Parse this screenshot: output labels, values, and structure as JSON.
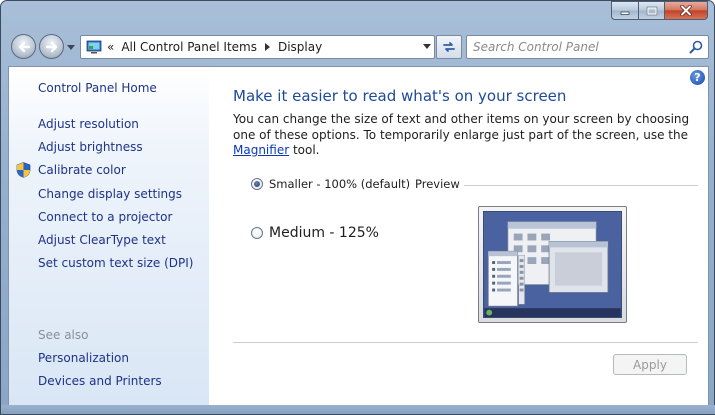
{
  "window": {
    "caption": {
      "minimize_icon": "minimize-icon",
      "maximize_icon": "maximize-icon",
      "close_icon": "close-icon"
    }
  },
  "navbar": {
    "back_icon": "back-arrow-icon",
    "forward_icon": "forward-arrow-icon",
    "address": {
      "overflow_chevron": "«",
      "crumbs": [
        "All Control Panel Items",
        "Display"
      ]
    },
    "refresh_icon": "refresh-icon",
    "search": {
      "placeholder": "Search Control Panel",
      "value": ""
    }
  },
  "sidebar": {
    "home": "Control Panel Home",
    "links": [
      "Adjust resolution",
      "Adjust brightness",
      "Calibrate color",
      "Change display settings",
      "Connect to a projector",
      "Adjust ClearType text",
      "Set custom text size (DPI)"
    ],
    "see_also": {
      "heading": "See also",
      "links": [
        "Personalization",
        "Devices and Printers"
      ]
    }
  },
  "main": {
    "help": "?",
    "title": "Make it easier to read what's on your screen",
    "description_before": "You can change the size of text and other items on your screen by choosing one of these options. To temporarily enlarge just part of the screen, use the ",
    "magnifier_link": "Magnifier",
    "description_after": " tool.",
    "options": [
      {
        "label": "Smaller - 100% (default)",
        "checked": true
      },
      {
        "label": "Medium - 125%",
        "checked": false
      }
    ],
    "preview_label": "Preview",
    "apply_label": "Apply",
    "apply_enabled": false
  },
  "colors": {
    "title": "#1e4a9a",
    "link": "#1e3287",
    "sidebar_bottom": "#d9e6f5",
    "frame": "#96b0cf"
  }
}
